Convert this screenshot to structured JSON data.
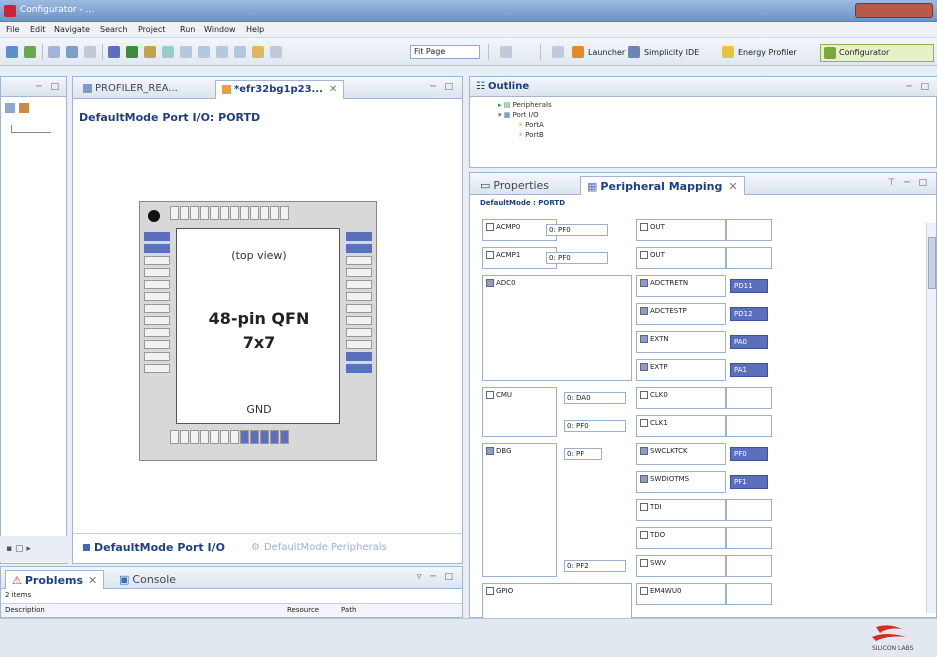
{
  "window": {
    "title": "Configurator - ..."
  },
  "menu": [
    "File",
    "Edit",
    "Navigate",
    "Search",
    "Project",
    "Run",
    "Window",
    "Help"
  ],
  "toolbar": {
    "zoom": "Fit Page",
    "launcher": "Launcher",
    "simplicity_ide": "Simplicity IDE",
    "energy_profiler": "Energy Profiler",
    "configurator": "Configurator"
  },
  "editor": {
    "tabs": [
      {
        "label": "PROFILER_REA..."
      },
      {
        "label": "*efr32bg1p23..."
      }
    ],
    "heading": "DefaultMode Port I/O: PORTD",
    "chip": {
      "view": "(top view)",
      "name": "48-pin QFN",
      "size": "7x7",
      "gnd": "GND"
    },
    "bottom_tabs": [
      {
        "label": "DefaultMode Port I/O"
      },
      {
        "label": "DefaultMode Peripherals"
      }
    ]
  },
  "outline": {
    "title": "Outline",
    "items": [
      {
        "label": "Peripherals"
      },
      {
        "label": "Port I/O"
      },
      {
        "label": "PortA"
      },
      {
        "label": "PortB"
      }
    ]
  },
  "properties": {
    "tabs": [
      {
        "label": "Properties"
      },
      {
        "label": "Peripheral Mapping"
      }
    ],
    "subtitle": "DefaultMode : PORTD",
    "rows": [
      {
        "peripheral": "ACMP0",
        "location": "0: PF0",
        "signal": "OUT",
        "pin": ""
      },
      {
        "peripheral": "ACMP1",
        "location": "0: PF0",
        "signal": "OUT",
        "pin": ""
      },
      {
        "peripheral": "ADC0",
        "location": "",
        "signal": "ADCTRETN",
        "pin": "PD11"
      },
      {
        "peripheral": "",
        "location": "",
        "signal": "ADCTESTP",
        "pin": "PD12"
      },
      {
        "peripheral": "",
        "location": "",
        "signal": "EXTN",
        "pin": "PA0"
      },
      {
        "peripheral": "",
        "location": "",
        "signal": "EXTP",
        "pin": "PA1"
      },
      {
        "peripheral": "CMU",
        "location": "0: DA0",
        "signal": "CLK0",
        "pin": ""
      },
      {
        "peripheral": "",
        "location": "0: PF0",
        "signal": "CLK1",
        "pin": ""
      },
      {
        "peripheral": "DBG",
        "location": "0: PF",
        "signal": "SWCLKTCK",
        "pin": "PF0"
      },
      {
        "peripheral": "",
        "location": "",
        "signal": "SWDIOTMS",
        "pin": "PF1"
      },
      {
        "peripheral": "",
        "location": "",
        "signal": "TDI",
        "pin": ""
      },
      {
        "peripheral": "",
        "location": "",
        "signal": "TDO",
        "pin": ""
      },
      {
        "peripheral": "",
        "location": "0: PF2",
        "signal": "SWV",
        "pin": ""
      },
      {
        "peripheral": "GPIO",
        "location": "",
        "signal": "EM4WU0",
        "pin": ""
      }
    ]
  },
  "problems": {
    "tabs": [
      {
        "label": "Problems"
      },
      {
        "label": "Console"
      }
    ],
    "count": "2 items",
    "cols": [
      "Description",
      "Resource",
      "Path"
    ]
  },
  "brand": "SILICON LABS"
}
